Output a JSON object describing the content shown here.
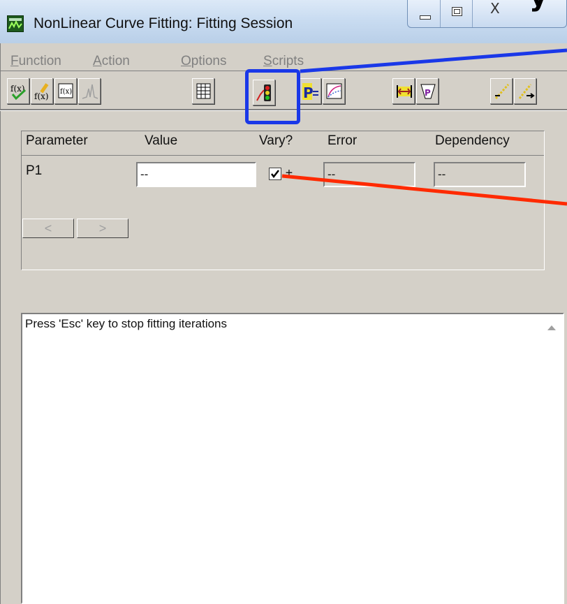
{
  "window": {
    "title": "NonLinear Curve Fitting:  Fitting Session",
    "close_symbol": "X",
    "cropped_heading_fragment": "y y"
  },
  "menu": [
    {
      "label": "Function",
      "accel": "F"
    },
    {
      "label": "Action",
      "accel": "A"
    },
    {
      "label": "Options",
      "accel": "O"
    },
    {
      "label": "Scripts",
      "accel": "S"
    }
  ],
  "toolbar_icons": [
    "formula-check-icon",
    "formula-edit-icon",
    "formula-view-icon",
    "peak-functions-icon",
    "worksheet-icon",
    "fit-iterate-traffic-light-icon",
    "parameters-icon",
    "fit-curve-icon",
    "fit-range-icon",
    "weight-icon",
    "fit-one-iteration-icon",
    "fit-until-converge-icon"
  ],
  "param_table": {
    "headers": [
      "Parameter",
      "Value",
      "Vary?",
      "Error",
      "Dependency"
    ],
    "rows": [
      {
        "name": "P1",
        "value": "--",
        "vary": true,
        "pm": "±",
        "error": "--",
        "dependency": "--"
      }
    ]
  },
  "nav": {
    "prev": "<",
    "next": ">"
  },
  "message": "Press 'Esc' key to stop fitting iterations",
  "colors": {
    "highlight": "#1a38e8",
    "annotation_red": "#ff2a00",
    "annotation_blue": "#1a38e8"
  }
}
